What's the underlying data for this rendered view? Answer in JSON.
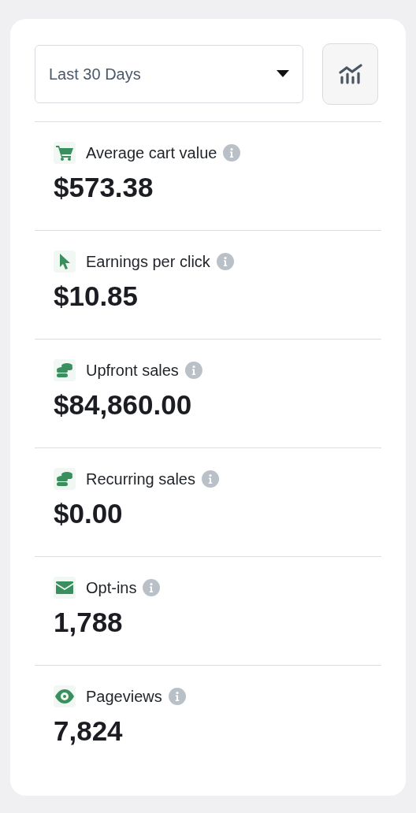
{
  "range_select": {
    "value": "Last 30 Days"
  },
  "metrics": [
    {
      "kind": "cart",
      "label": "Average cart value",
      "value": "$573.38"
    },
    {
      "kind": "cursor",
      "label": "Earnings per click",
      "value": "$10.85"
    },
    {
      "kind": "coins",
      "label": "Upfront sales",
      "value": "$84,860.00"
    },
    {
      "kind": "coins",
      "label": "Recurring sales",
      "value": "$0.00"
    },
    {
      "kind": "envelope",
      "label": "Opt-ins",
      "value": "1,788"
    },
    {
      "kind": "eye",
      "label": "Pageviews",
      "value": "7,824"
    }
  ]
}
